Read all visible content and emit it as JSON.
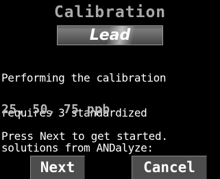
{
  "screen": {
    "title": "Calibration",
    "analyte": "Lead",
    "message_lines": [
      "Performing the calibration",
      "requires 3 standardized",
      "solutions from ANDalyze:"
    ],
    "concentrations": "25, 50, 75 ppb",
    "instruction": "Press Next to get started."
  },
  "buttons": {
    "next_label": "Next",
    "cancel_label": "Cancel"
  },
  "colors": {
    "background": "#000000",
    "title": "#a9a9a9",
    "text": "#ffffff",
    "concentrations": "#b8b8b8",
    "button_fill": "#4d4d4d"
  }
}
